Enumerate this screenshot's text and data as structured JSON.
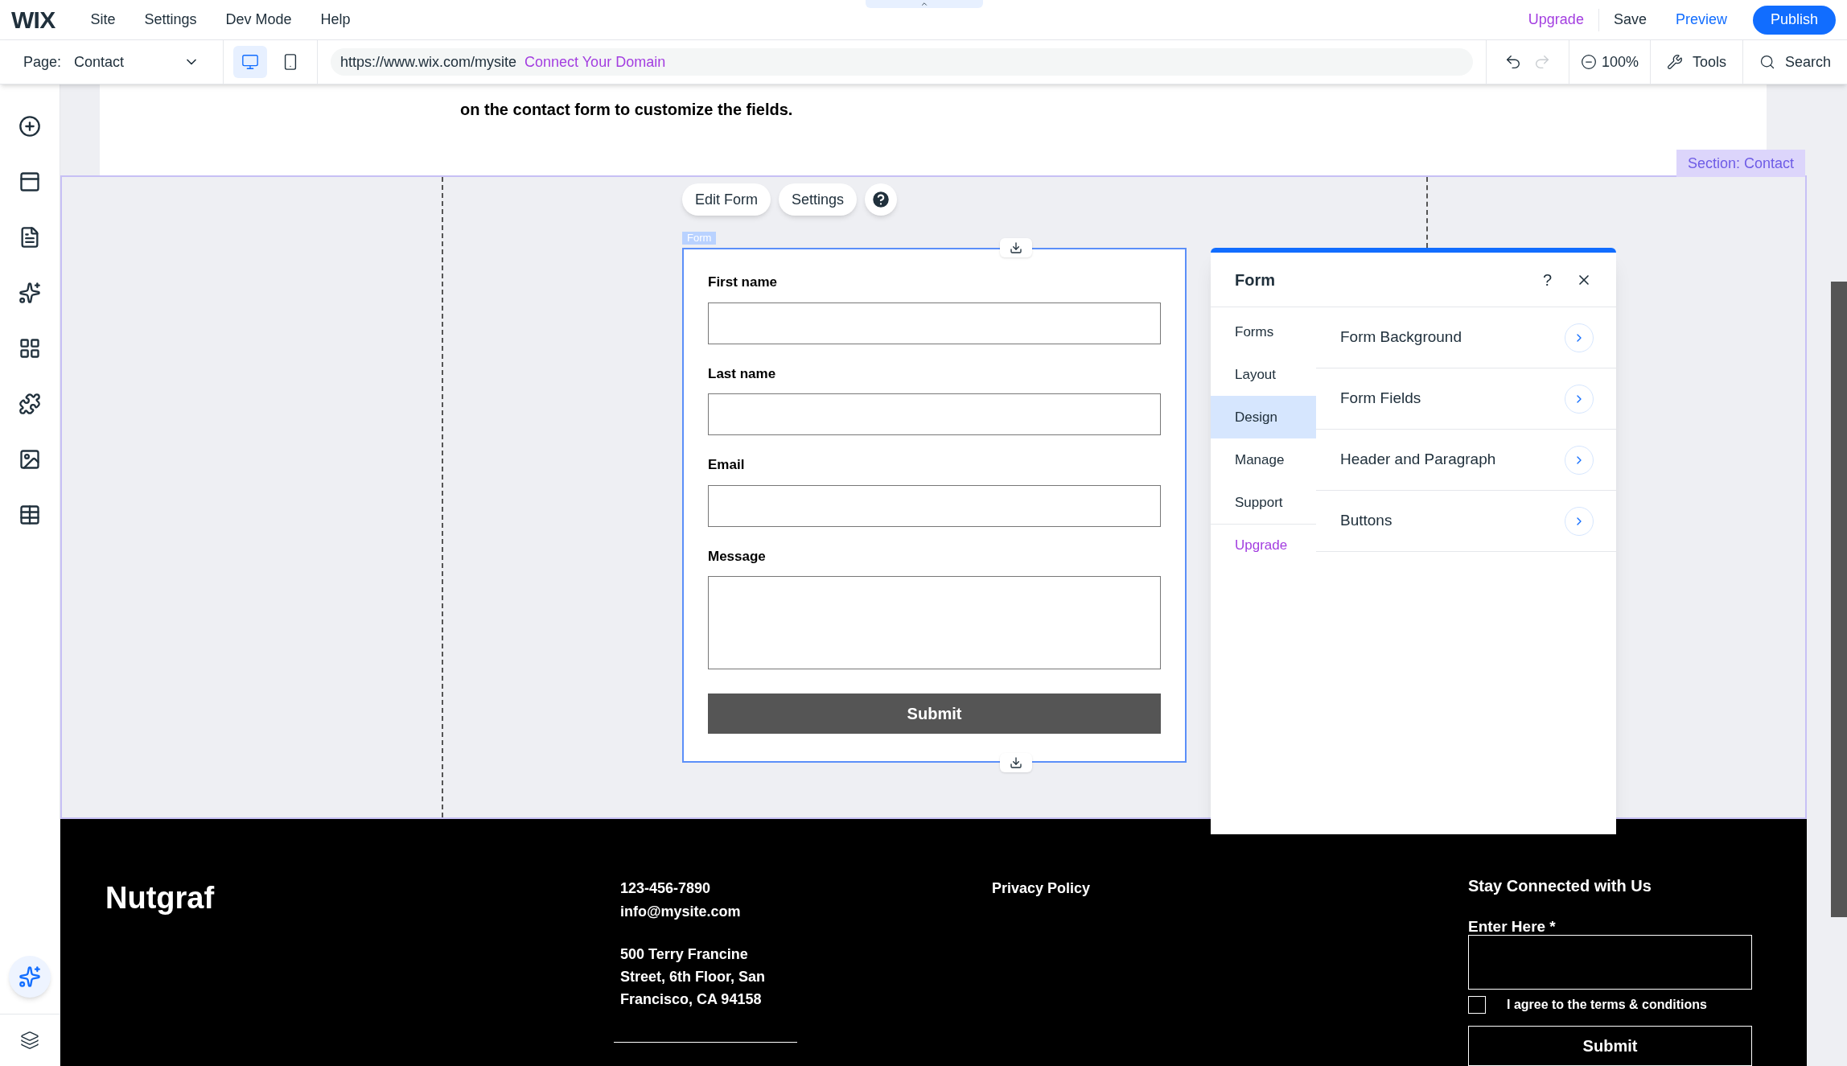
{
  "menu_bar": {
    "logo": "WIX",
    "menus": [
      "Site",
      "Settings",
      "Dev Mode",
      "Help"
    ],
    "upgrade": "Upgrade",
    "save": "Save",
    "preview": "Preview",
    "publish": "Publish"
  },
  "toolbar": {
    "page_label": "Page:",
    "page": "Contact",
    "devices": [
      {
        "kind": "desktop",
        "selected": true
      },
      {
        "kind": "mobile",
        "selected": false
      }
    ],
    "url": "https://www.wix.com/mysite",
    "connect_domain": "Connect Your Domain",
    "undo": {
      "disabled": false
    },
    "redo": {
      "disabled": true
    },
    "zoom": "100%",
    "tools": "Tools",
    "search": "Search"
  },
  "canvas": {
    "intro_text": "on the contact form to customize the fields.",
    "section_label": "Section: Contact",
    "form_actions": [
      "Edit Form",
      "Settings"
    ],
    "form_tag": "Form",
    "fields": [
      {
        "label": "First name",
        "kind": "text"
      },
      {
        "label": "Last name",
        "kind": "text"
      },
      {
        "label": "Email",
        "kind": "text"
      },
      {
        "label": "Message",
        "kind": "textarea"
      }
    ],
    "submit": "Submit"
  },
  "panel": {
    "title": "Form",
    "help": "?",
    "tabs": [
      {
        "label": "Forms",
        "kind": "tab",
        "selected": false
      },
      {
        "label": "Layout",
        "kind": "tab",
        "selected": false
      },
      {
        "label": "Design",
        "kind": "tab",
        "selected": true
      },
      {
        "label": "Manage",
        "kind": "tab",
        "selected": false
      },
      {
        "label": "Support",
        "kind": "tab",
        "selected": false
      },
      {
        "label": "Upgrade",
        "kind": "upgrade",
        "selected": false
      }
    ],
    "items": [
      "Form Background",
      "Form Fields",
      "Header and Paragraph",
      "Buttons"
    ]
  },
  "footer": {
    "brand": "Nutgraf",
    "phone": "123-456-7890",
    "email": "info@mysite.com",
    "address": [
      "500 Terry Francine",
      "Street, 6th Floor, San",
      "Francisco, CA 94158"
    ],
    "privacy": "Privacy Policy",
    "newsletter_title": "Stay Connected with Us",
    "field_label": "Enter Here *",
    "consent": {
      "label": "I agree to the terms & conditions",
      "checked": false
    },
    "submit": "Submit"
  }
}
